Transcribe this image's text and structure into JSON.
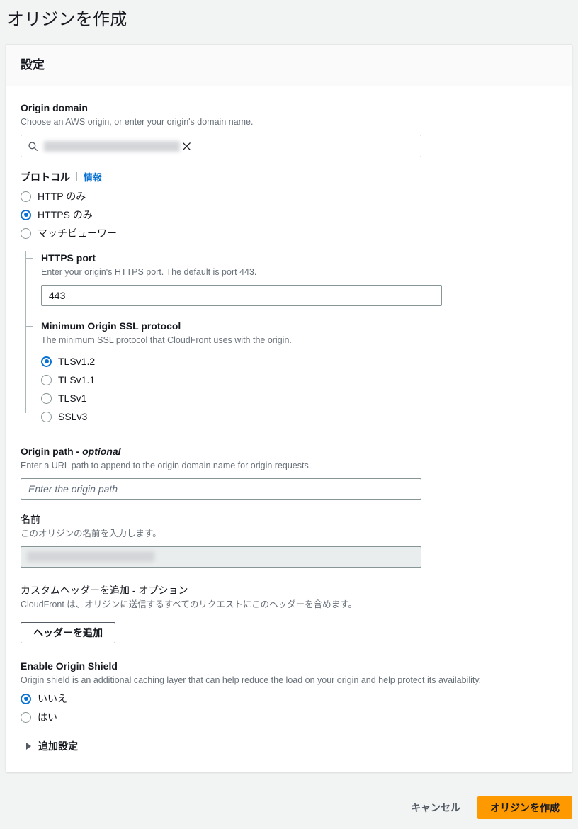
{
  "page": {
    "title": "オリジンを作成"
  },
  "card": {
    "header_title": "設定"
  },
  "origin_domain": {
    "label": "Origin domain",
    "description": "Choose an AWS origin, or enter your origin's domain name.",
    "value": "",
    "search_icon": "search-icon",
    "clear_icon": "close-icon"
  },
  "protocol": {
    "label": "プロトコル",
    "info_link": "情報",
    "options": [
      {
        "label": "HTTP のみ",
        "selected": false
      },
      {
        "label": "HTTPS のみ",
        "selected": true
      },
      {
        "label": "マッチビューワー",
        "selected": false
      }
    ]
  },
  "https_port": {
    "label": "HTTPS port",
    "description": "Enter your origin's HTTPS port. The default is port 443.",
    "value": "443"
  },
  "min_ssl": {
    "label": "Minimum Origin SSL protocol",
    "description": "The minimum SSL protocol that CloudFront uses with the origin.",
    "options": [
      {
        "label": "TLSv1.2",
        "selected": true
      },
      {
        "label": "TLSv1.1",
        "selected": false
      },
      {
        "label": "TLSv1",
        "selected": false
      },
      {
        "label": "SSLv3",
        "selected": false
      }
    ]
  },
  "origin_path": {
    "label": "Origin path - ",
    "label_optional": "optional",
    "description": "Enter a URL path to append to the origin domain name for origin requests.",
    "placeholder": "Enter the origin path",
    "value": ""
  },
  "name": {
    "label": "名前",
    "description": "このオリジンの名前を入力します。",
    "value": ""
  },
  "custom_headers": {
    "label": "カスタムヘッダーを追加 - オプション",
    "description": "CloudFront は、オリジンに送信するすべてのリクエストにこのヘッダーを含めます。",
    "add_button": "ヘッダーを追加"
  },
  "origin_shield": {
    "label": "Enable Origin Shield",
    "description": "Origin shield is an additional caching layer that can help reduce the load on your origin and help protect its availability.",
    "options": [
      {
        "label": "いいえ",
        "selected": true
      },
      {
        "label": "はい",
        "selected": false
      }
    ]
  },
  "additional_settings": {
    "label": "追加設定",
    "expanded": false,
    "caret_icon": "chevron-right-icon"
  },
  "footer": {
    "cancel_label": "キャンセル",
    "submit_label": "オリジンを作成"
  },
  "colors": {
    "accent_blue": "#0972d3",
    "primary_orange": "#ff9900",
    "page_bg": "#f2f3f3",
    "text": "#16191f",
    "muted_text": "#687078"
  }
}
